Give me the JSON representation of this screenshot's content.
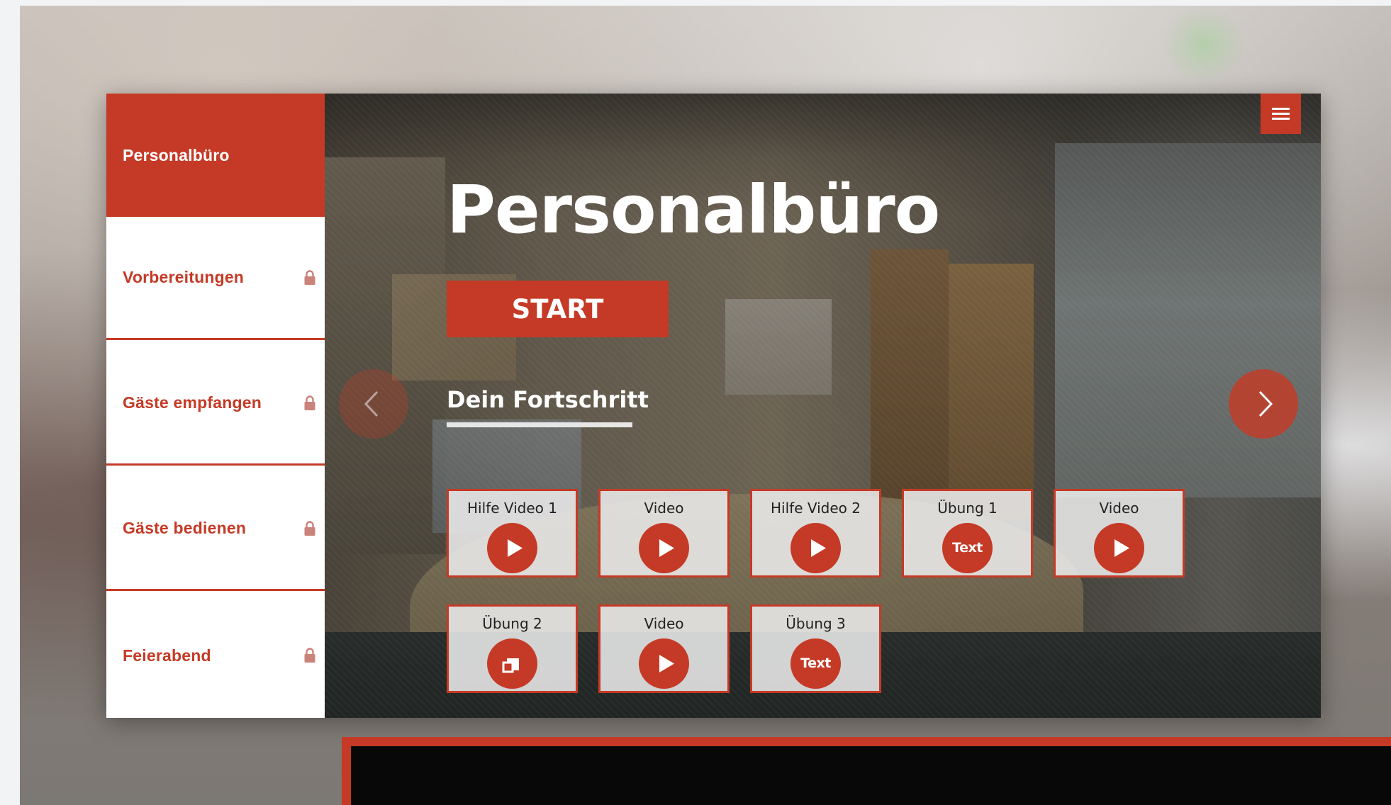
{
  "sidebar": {
    "items": [
      {
        "label": "Personalbüro",
        "active": true,
        "locked": false
      },
      {
        "label": "Vorbereitungen",
        "active": false,
        "locked": true
      },
      {
        "label": "Gäste empfangen",
        "active": false,
        "locked": true
      },
      {
        "label": "Gäste bedienen",
        "active": false,
        "locked": true
      },
      {
        "label": "Feierabend",
        "active": false,
        "locked": true
      }
    ]
  },
  "hero": {
    "title": "Personalbüro",
    "start_label": "START",
    "progress_label": "Dein Fortschritt",
    "progress_value": 1.0
  },
  "tiles": [
    {
      "label": "Hilfe Video 1",
      "icon": "play-icon"
    },
    {
      "label": "Video",
      "icon": "play-icon"
    },
    {
      "label": "Hilfe Video 2",
      "icon": "play-icon"
    },
    {
      "label": "Übung 1",
      "icon": "text-exercise-icon",
      "icon_text": "Text"
    },
    {
      "label": "Video",
      "icon": "play-icon"
    },
    {
      "label": "Übung 2",
      "icon": "drag-drop-icon"
    },
    {
      "label": "Video",
      "icon": "play-icon"
    },
    {
      "label": "Übung 3",
      "icon": "text-exercise-icon",
      "icon_text": "Text"
    }
  ],
  "colors": {
    "accent": "#c53a26",
    "tile_bg": "#ebebeb",
    "panel_dark": "#080808"
  }
}
